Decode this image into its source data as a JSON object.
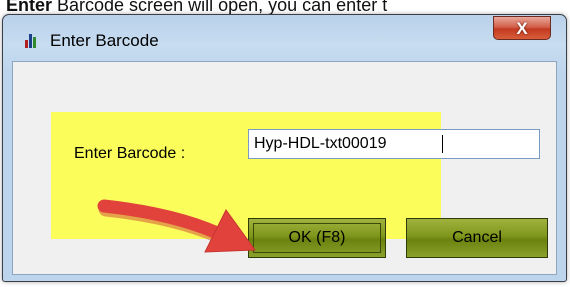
{
  "caption": {
    "bold_text": "Enter",
    "rest_text": " Barcode screen will open, you can enter t"
  },
  "window": {
    "title": "Enter Barcode",
    "close_glyph": "X",
    "close_color": "#c43a21"
  },
  "form": {
    "label": "Enter Barcode :",
    "barcode_value": "Hyp-HDL-txt00019",
    "highlight_color": "#fbfd5b"
  },
  "buttons": {
    "ok_label": "OK (F8)",
    "cancel_label": "Cancel",
    "button_color": "#7f961c"
  },
  "annotation": {
    "arrow_color": "#e2423c",
    "arrow_icon": "arrow-pointer-icon"
  }
}
